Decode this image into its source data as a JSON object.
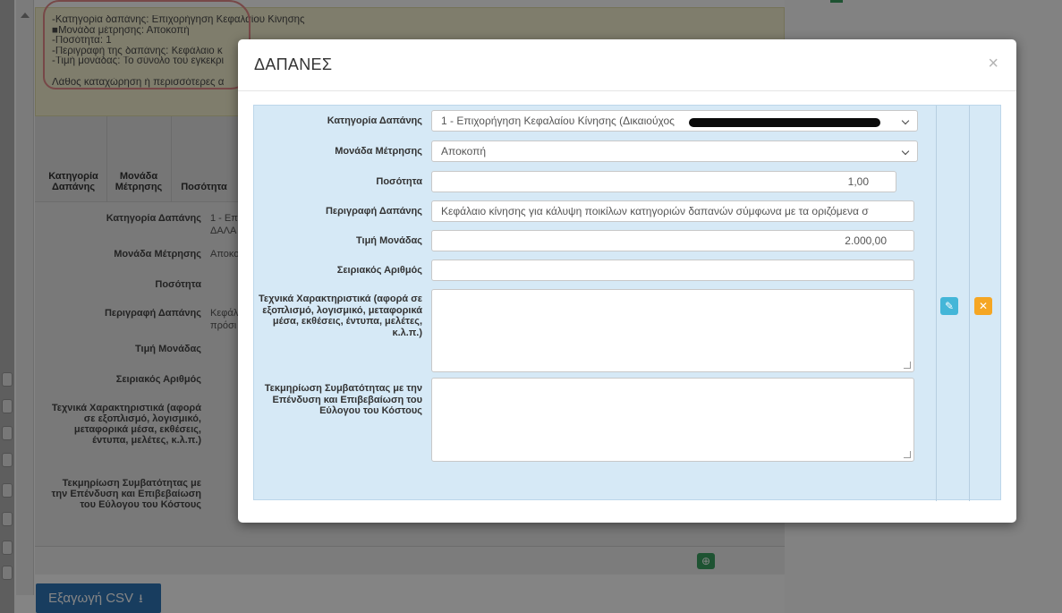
{
  "background": {
    "info_lines": [
      "-Κατηγορία δαπάνης: Επιχορήγηση Κεφαλαίου Κίνησης",
      "■Μονάδα μέτρησης: Αποκοπή",
      "-Ποσότητα: 1",
      "-Περιγραφή της δαπάνης: Κεφάλαιο κ",
      "-Τιμή μονάδας: Το σύνολο του εγκεκρι"
    ],
    "error_text": "Λάθος καταχώρηση ή περισσότερες α",
    "table_headers": [
      "Κατηγορία Δαπάνης",
      "Μονάδα Μέτρησης",
      "Ποσότητα"
    ],
    "row_labels": [
      "Κατηγορία Δαπάνης",
      "Μονάδα Μέτρησης",
      "Ποσότητα",
      "Περιγραφή Δαπάνης",
      "Τιμή Μονάδας",
      "Σειριακός Αριθμός",
      "Τεχνικά Χαρακτηριστικά (αφορά σε εξοπλισμό, λογισμικό, μεταφορικά μέσα, εκθέσεις, έντυπα, μελέτες, κ.λ.π.)",
      "Τεκμηρίωση Συμβατότητας με την Επένδυση και Επιβεβαίωση του Εύλογου του Κόστους"
    ],
    "row_values": {
      "category_line1": "1 - Επ",
      "category_line2": "ΔΑΛΑ",
      "unit": "Αποκο",
      "description_line1": "Κεφάλ",
      "description_line2": "πρόσι"
    },
    "csv_button_label": "Εξαγωγή CSV",
    "csv_icon": "download-icon",
    "add_icon": "plus-circle-icon"
  },
  "modal": {
    "title": "ΔΑΠΑΝΕΣ",
    "close_glyph": "×",
    "fields": {
      "category": {
        "label": "Κατηγορία Δαπάνης",
        "value": "1 - Επιχορήγηση Κεφαλαίου Κίνησης (Δικαιούχος"
      },
      "unit": {
        "label": "Μονάδα Μέτρησης",
        "value": "Αποκοπή"
      },
      "quantity": {
        "label": "Ποσότητα",
        "value": "1,00"
      },
      "description": {
        "label": "Περιγραφή Δαπάνης",
        "value": "Κεφάλαιο κίνησης για κάλυψη ποικίλων κατηγοριών δαπανών σύμφωνα με τα οριζόμενα σ"
      },
      "unit_price": {
        "label": "Τιμή Μονάδας",
        "value": "2.000,00"
      },
      "serial": {
        "label": "Σειριακός Αριθμός",
        "value": ""
      },
      "technical": {
        "label": "Τεχνικά Χαρακτηριστικά (αφορά σε εξοπλισμό, λογισμικό, μεταφορικά μέσα, εκθέσεις, έντυπα, μελέτες, κ.λ.π.)",
        "value": ""
      },
      "justification": {
        "label": "Τεκμηρίωση Συμβατότητας με την Επένδυση και Επιβεβαίωση του Εύλογου του Κόστους",
        "value": ""
      }
    },
    "actions": {
      "edit_icon": "edit-icon",
      "delete_icon": "delete-x-icon"
    },
    "colors": {
      "panel_bg": "#d6e9f6",
      "edit_btn": "#44b6d8",
      "delete_btn": "#f5a623"
    }
  }
}
